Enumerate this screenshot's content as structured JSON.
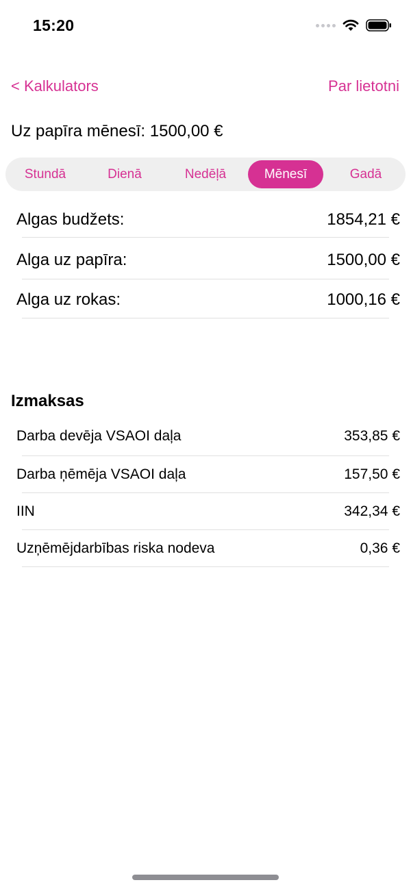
{
  "status_bar": {
    "time": "15:20"
  },
  "nav": {
    "back_label": "< Kalkulators",
    "about_label": "Par lietotni"
  },
  "summary": {
    "text": "Uz papīra mēnesī: 1500,00 €"
  },
  "period_tabs": {
    "items": [
      "Stundā",
      "Dienā",
      "Nedēļā",
      "Mēnesī",
      "Gadā"
    ],
    "selected": "Mēnesī"
  },
  "salary": {
    "rows": [
      {
        "label": "Algas budžets:",
        "value": "1854,21 €"
      },
      {
        "label": "Alga uz papīra:",
        "value": "1500,00 €"
      },
      {
        "label": "Alga uz rokas:",
        "value": "1000,16 €"
      }
    ]
  },
  "payments": {
    "title": "Izmaksas",
    "rows": [
      {
        "label": "Darba devēja VSAOI daļa",
        "value": "353,85 €"
      },
      {
        "label": "Darba ņēmēja VSAOI daļa",
        "value": "157,50 €"
      },
      {
        "label": "IIN",
        "value": "342,34 €"
      },
      {
        "label": "Uzņēmējdarbības riska nodeva",
        "value": "0,36 €"
      }
    ]
  },
  "colors": {
    "accent": "#d63193",
    "segment_bg": "#efefef",
    "divider": "#e0e0e0"
  },
  "icons": [
    "cellular-signal-icon",
    "wifi-icon",
    "battery-icon"
  ]
}
